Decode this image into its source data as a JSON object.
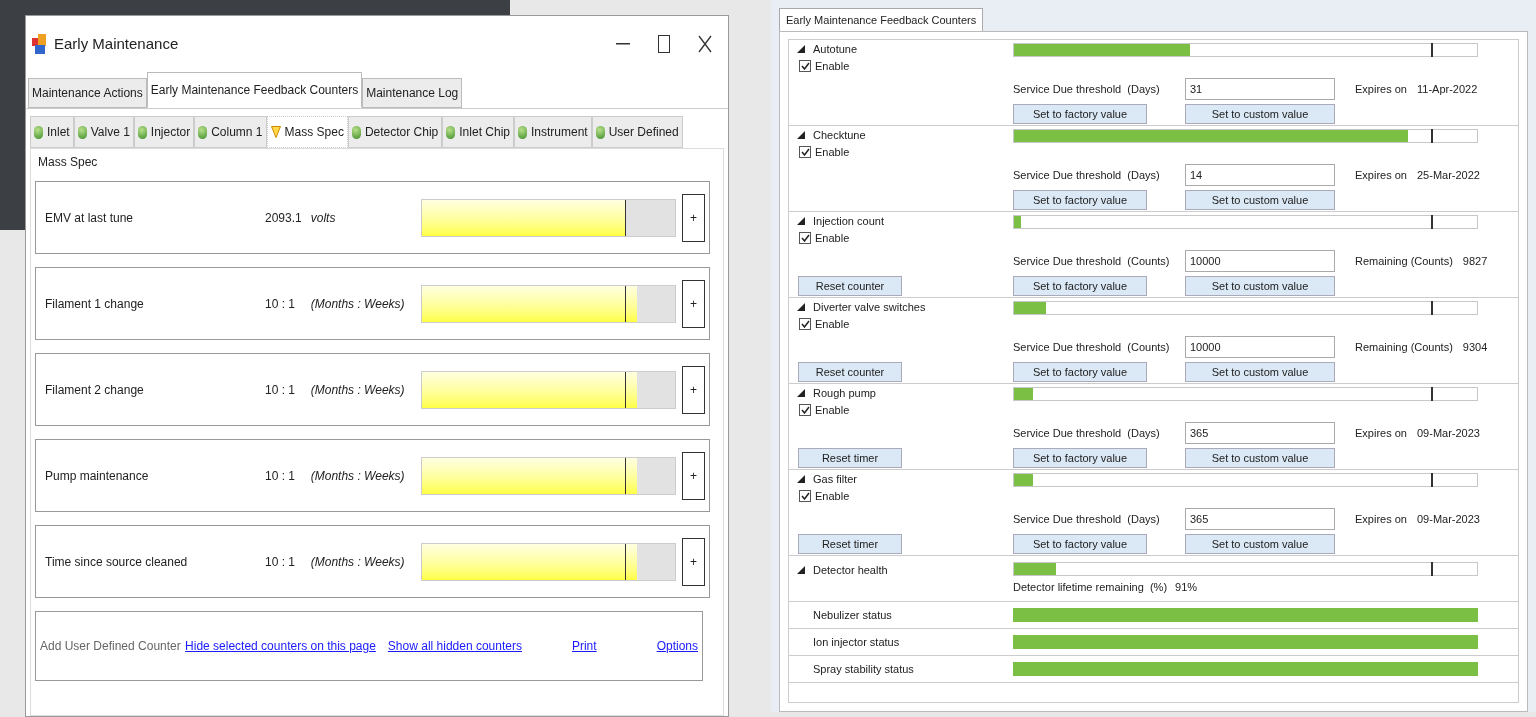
{
  "left_window": {
    "title": "Early Maintenance",
    "tabs": [
      {
        "label": "Maintenance Actions",
        "selected": false
      },
      {
        "label": "Early Maintenance Feedback Counters",
        "selected": true
      },
      {
        "label": "Maintenance Log",
        "selected": false
      }
    ],
    "subtabs": [
      {
        "label": "Inlet",
        "selected": false,
        "kind": "ok"
      },
      {
        "label": "Valve 1",
        "selected": false,
        "kind": "ok"
      },
      {
        "label": "Injector",
        "selected": false,
        "kind": "ok"
      },
      {
        "label": "Column 1",
        "selected": false,
        "kind": "ok"
      },
      {
        "label": "Mass Spec",
        "selected": true,
        "kind": "warning"
      },
      {
        "label": "Detector Chip",
        "selected": false,
        "kind": "ok"
      },
      {
        "label": "Inlet Chip",
        "selected": false,
        "kind": "ok"
      },
      {
        "label": "Instrument",
        "selected": false,
        "kind": "ok"
      },
      {
        "label": "User Defined",
        "selected": false,
        "kind": "ok"
      }
    ],
    "group_title": "Mass Spec",
    "counters": [
      {
        "name": "EMV at last tune",
        "value": "2093.1",
        "unit": "volts",
        "level": 0.8,
        "button": "+"
      },
      {
        "name": "Filament 1 change",
        "value": "10 : 1",
        "unit": "(Months : Weeks)",
        "level": 0.85,
        "button": "+"
      },
      {
        "name": "Filament 2 change",
        "value": "10 : 1",
        "unit": "(Months : Weeks)",
        "level": 0.85,
        "button": "+"
      },
      {
        "name": "Pump maintenance",
        "value": "10 : 1",
        "unit": "(Months : Weeks)",
        "level": 0.85,
        "button": "+"
      },
      {
        "name": "Time since source cleaned",
        "value": "10 : 1",
        "unit": "(Months : Weeks)",
        "level": 0.85,
        "button": "+"
      }
    ],
    "footer": {
      "label": "Add User Defined Counter",
      "links": [
        "Hide selected counters on this page",
        "Show all hidden counters",
        "Print",
        "Options"
      ]
    }
  },
  "right_window": {
    "tab": {
      "label": "Early Maintenance Feedback Counters",
      "selected": true
    },
    "sections": [
      {
        "kind": "counter",
        "name": "Autotune",
        "enable_label": "Enable",
        "enabled": true,
        "level": 0.38,
        "threshold_label": "Service Due threshold  (Days)",
        "threshold_value": "31",
        "info_label": "Expires on",
        "info_value": "11-Apr-2022",
        "buttons": [
          "Set to factory value",
          "Set to custom value"
        ]
      },
      {
        "kind": "counter",
        "name": "Checktune",
        "enable_label": "Enable",
        "enabled": true,
        "level": 0.85,
        "threshold_label": "Service Due threshold  (Days)",
        "threshold_value": "14",
        "info_label": "Expires on",
        "info_value": "25-Mar-2022",
        "buttons": [
          "Set to factory value",
          "Set to custom value"
        ]
      },
      {
        "kind": "counter",
        "name": "Injection count",
        "enable_label": "Enable",
        "enabled": true,
        "level": 0.015,
        "threshold_label": "Service Due threshold  (Counts)",
        "threshold_value": "10000",
        "info_label": "Remaining (Counts)",
        "info_value": "9827",
        "reset": "Reset counter",
        "buttons": [
          "Set to factory value",
          "Set to custom value"
        ]
      },
      {
        "kind": "counter",
        "name": "Diverter valve switches",
        "enable_label": "Enable",
        "enabled": true,
        "level": 0.07,
        "threshold_label": "Service Due threshold  (Counts)",
        "threshold_value": "10000",
        "info_label": "Remaining (Counts)",
        "info_value": "9304",
        "reset": "Reset counter",
        "buttons": [
          "Set to factory value",
          "Set to custom value"
        ]
      },
      {
        "kind": "counter",
        "name": "Rough pump",
        "enable_label": "Enable",
        "enabled": true,
        "level": 0.04,
        "threshold_label": "Service Due threshold  (Days)",
        "threshold_value": "365",
        "info_label": "Expires on",
        "info_value": "09-Mar-2023",
        "reset": "Reset timer",
        "buttons": [
          "Set to factory value",
          "Set to custom value"
        ]
      },
      {
        "kind": "counter",
        "name": "Gas filter",
        "enable_label": "Enable",
        "enabled": true,
        "level": 0.04,
        "threshold_label": "Service Due threshold  (Days)",
        "threshold_value": "365",
        "info_label": "Expires on",
        "info_value": "09-Mar-2023",
        "reset": "Reset timer",
        "buttons": [
          "Set to factory value",
          "Set to custom value"
        ]
      },
      {
        "kind": "health",
        "name": "Detector health",
        "level": 0.09,
        "reading_label": "Detector lifetime remaining  (%)",
        "reading_value": "91%"
      },
      {
        "kind": "status",
        "name": "Nebulizer status"
      },
      {
        "kind": "status",
        "name": "Ion injector status"
      },
      {
        "kind": "status",
        "name": "Spray stability status"
      }
    ]
  }
}
